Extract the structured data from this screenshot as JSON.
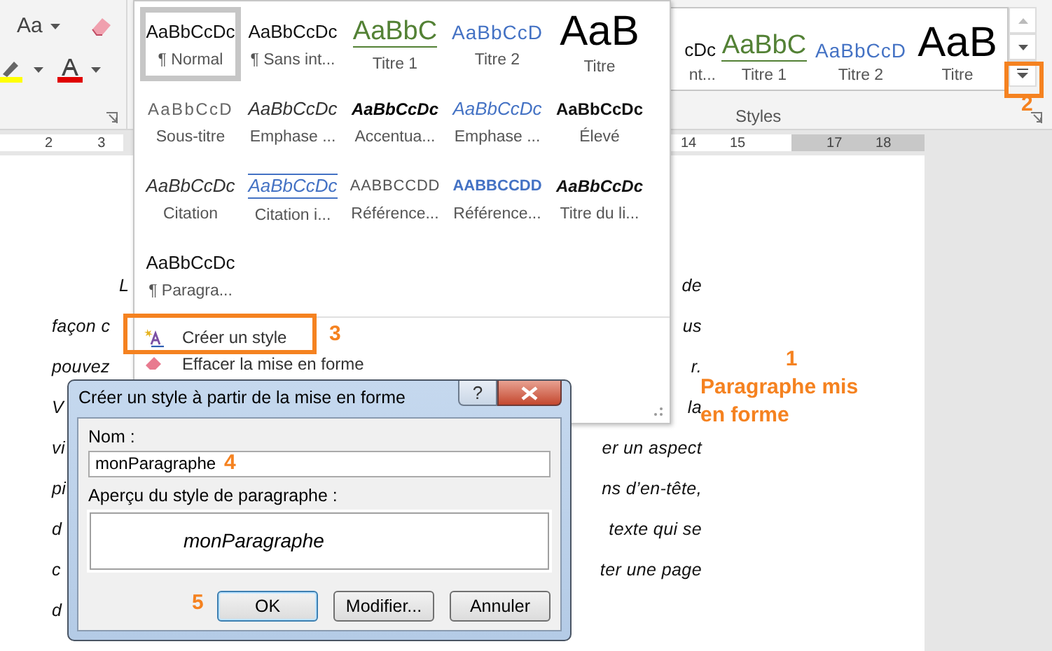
{
  "ribbon": {
    "change_case_button": "Aa",
    "styles_group_label": "Styles",
    "gallery": [
      {
        "sample": "cDc",
        "label": "nt...",
        "kind": "plain"
      },
      {
        "sample": "AaBbC",
        "label": "Titre 1",
        "kind": "heading1"
      },
      {
        "sample": "AaBbCcD",
        "label": "Titre 2",
        "kind": "heading2"
      },
      {
        "sample": "AaB",
        "label": "Titre",
        "kind": "title"
      }
    ]
  },
  "ruler": {
    "left_labels": [
      "2",
      "3"
    ],
    "right_labels": [
      "14",
      "15",
      "17",
      "18"
    ]
  },
  "document": {
    "lines": [
      {
        "left": "L",
        "right": "de"
      },
      {
        "left": "façon c",
        "right": "us"
      },
      {
        "left": "pouvez",
        "right": "r."
      },
      {
        "left": "V",
        "right": "la"
      },
      {
        "left": "vi",
        "right": "er un aspect"
      },
      {
        "left": "pi",
        "right": "ns d’en-tête,"
      },
      {
        "left": "d",
        "right": "texte  qui  se"
      },
      {
        "left": "c",
        "right": "ter une page"
      },
      {
        "left": "d"
      }
    ]
  },
  "styles_menu": {
    "items": [
      {
        "sample": "AaBbCcDc",
        "label": "¶ Normal",
        "kind": "plain",
        "selected": true
      },
      {
        "sample": "AaBbCcDc",
        "label": "¶ Sans int...",
        "kind": "plain",
        "selected": false
      },
      {
        "sample": "AaBbC",
        "label": "Titre 1",
        "kind": "heading1",
        "selected": false
      },
      {
        "sample": "AaBbCcD",
        "label": "Titre 2",
        "kind": "heading2",
        "selected": false
      },
      {
        "sample": "AaB",
        "label": "Titre",
        "kind": "title",
        "selected": false
      },
      {
        "sample": "AaBbCcD",
        "label": "Sous-titre",
        "kind": "subtitle",
        "selected": false
      },
      {
        "sample": "AaBbCcDc",
        "label": "Emphase ...",
        "kind": "emphasis",
        "selected": false
      },
      {
        "sample": "AaBbCcDc",
        "label": "Accentua...",
        "kind": "accent",
        "selected": false
      },
      {
        "sample": "AaBbCcDc",
        "label": "Emphase ...",
        "kind": "emphasis_blue",
        "selected": false
      },
      {
        "sample": "AaBbCcDc",
        "label": "Élevé",
        "kind": "strong",
        "selected": false
      },
      {
        "sample": "AaBbCcDc",
        "label": "Citation",
        "kind": "quote",
        "selected": false
      },
      {
        "sample": "AaBbCcDc",
        "label": "Citation i...",
        "kind": "quote_intense",
        "selected": false
      },
      {
        "sample": "AABBCCDD",
        "label": "Référence...",
        "kind": "reference",
        "selected": false
      },
      {
        "sample": "AABBCCDD",
        "label": "Référence...",
        "kind": "reference_intense",
        "selected": false
      },
      {
        "sample": "AaBbCcDc",
        "label": "Titre du li...",
        "kind": "book_title",
        "selected": false
      },
      {
        "sample": "AaBbCcDc",
        "label": "¶ Paragra...",
        "kind": "plain",
        "selected": false
      }
    ],
    "commands": [
      {
        "label": "Créer un style",
        "kind": "create"
      },
      {
        "label": "Effacer la mise en forme",
        "kind": "clear"
      }
    ]
  },
  "dialog": {
    "title": "Créer un style à partir de la mise en forme",
    "help_button": "?",
    "name_label": "Nom :",
    "name_value": "monParagraphe",
    "preview_label": "Aperçu du style de paragraphe :",
    "preview_text": "monParagraphe",
    "buttons": [
      {
        "label": "OK",
        "default": true
      },
      {
        "label": "Modifier...",
        "default": false
      },
      {
        "label": "Annuler",
        "default": false
      }
    ]
  },
  "annotations": {
    "note_number": "1",
    "note_text": "Paragraphe mis en forme",
    "gallery_more_marker": "2",
    "create_style_marker": "3",
    "name_field_marker": "4",
    "ok_marker": "5"
  }
}
